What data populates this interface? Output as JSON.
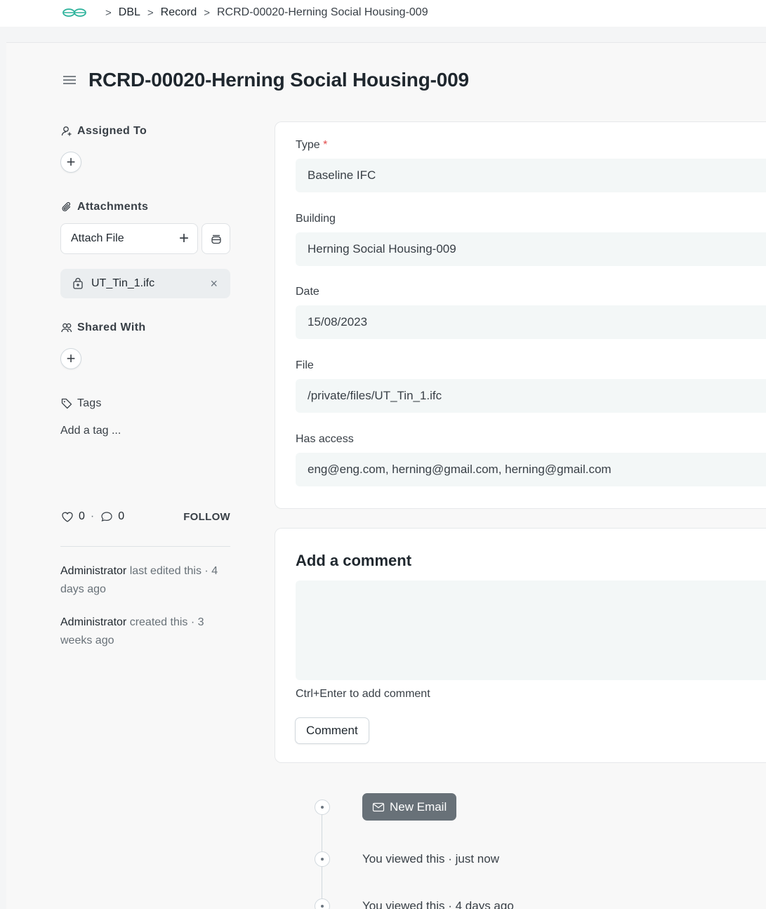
{
  "breadcrumb": {
    "logo_icon": "frappe-logo-icon",
    "items": [
      "DBL",
      "Record",
      "RCRD-00020-Herning Social Housing-009"
    ]
  },
  "page": {
    "title": "RCRD-00020-Herning Social Housing-009"
  },
  "sidebar": {
    "assigned_to_label": "Assigned To",
    "attachments_label": "Attachments",
    "attach_file_label": "Attach File",
    "attachment_name": "UT_Tin_1.ifc",
    "shared_with_label": "Shared With",
    "tags_label": "Tags",
    "add_tag_placeholder": "Add a tag ...",
    "likes_count": "0",
    "separator": "·",
    "comments_count": "0",
    "follow_label": "FOLLOW",
    "activity": [
      {
        "who": "Administrator",
        "what": " last edited this · 4 days ago"
      },
      {
        "who": "Administrator",
        "what": " created this · 3 weeks ago"
      }
    ]
  },
  "form": {
    "type_label": "Type",
    "required_mark": "*",
    "type_value": "Baseline IFC",
    "building_label": "Building",
    "building_value": "Herning Social Housing-009",
    "date_label": "Date",
    "date_value": "15/08/2023",
    "file_label": "File",
    "file_value": "/private/files/UT_Tin_1.ifc",
    "has_access_label": "Has access",
    "has_access_value": "eng@eng.com, herning@gmail.com, herning@gmail.com"
  },
  "comment": {
    "title": "Add a comment",
    "hint": "Ctrl+Enter to add comment",
    "button_label": "Comment"
  },
  "timeline": {
    "new_email_label": "New Email",
    "entries": [
      "You viewed this · just now",
      "You viewed this · 4 days ago"
    ]
  },
  "colors": {
    "required": "#e24c4c",
    "input_bg": "#f3f7f7",
    "new_email_bg": "#687178"
  }
}
